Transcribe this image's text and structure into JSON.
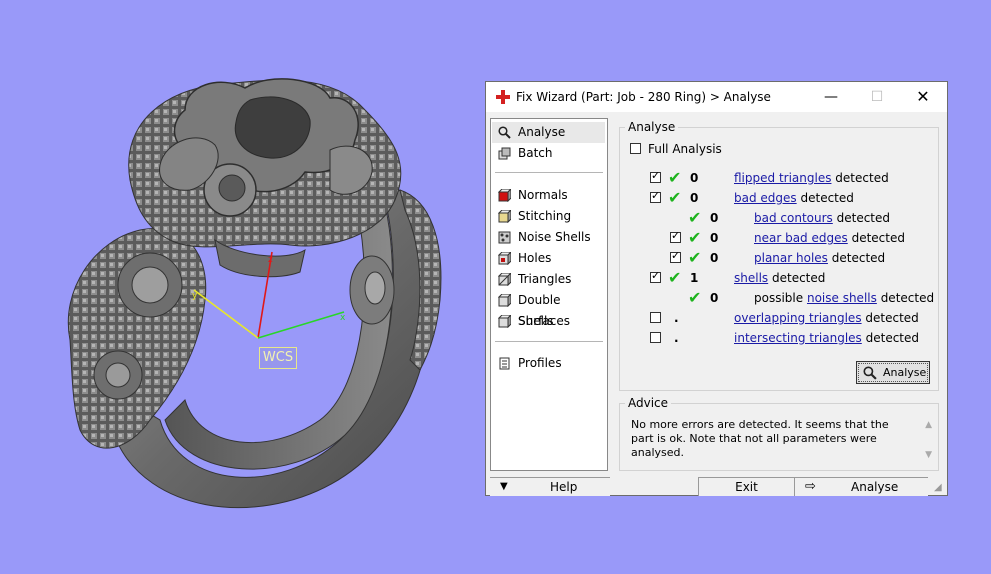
{
  "viewport": {
    "wcs_label": "WCS"
  },
  "dialog": {
    "title": "Fix Wizard (Part: Job - 280 Ring) > Analyse",
    "window_controls": {
      "minimize": "—",
      "maximize": "☐",
      "close": "✕"
    },
    "nav_items": [
      {
        "label": "Analyse",
        "icon": "magnifier-icon",
        "selected": true
      },
      {
        "label": "Batch",
        "icon": "batch-icon"
      },
      {
        "label": "Normals",
        "icon": "normals-cube-icon"
      },
      {
        "label": "Stitching",
        "icon": "stitching-cube-icon"
      },
      {
        "label": "Noise Shells",
        "icon": "noise-shells-icon"
      },
      {
        "label": "Holes",
        "icon": "holes-cube-icon"
      },
      {
        "label": "Triangles",
        "icon": "triangles-cube-icon"
      },
      {
        "label": "Double Surfaces",
        "icon": "double-surfaces-icon"
      },
      {
        "label": "Shells",
        "icon": "shells-cube-icon"
      },
      {
        "label": "Profiles",
        "icon": "profiles-icon"
      }
    ],
    "analyse_group": {
      "title": "Analyse",
      "full_analysis": "Full Analysis",
      "results": [
        {
          "count": "0",
          "link": "flipped triangles",
          "suffix": "detected",
          "checked": true,
          "ok": true
        },
        {
          "count": "0",
          "link": "bad edges",
          "suffix": "detected",
          "checked": true,
          "ok": true
        },
        {
          "count": "0",
          "link": "bad contours",
          "suffix": "detected",
          "ok": true
        },
        {
          "count": "0",
          "link": "near bad edges",
          "suffix": "detected",
          "checked": true,
          "ok": true
        },
        {
          "count": "0",
          "link": "planar holes",
          "suffix": "detected",
          "checked": true,
          "ok": true
        },
        {
          "count": "1",
          "link": "shells",
          "suffix": "detected",
          "checked": true,
          "ok": true
        },
        {
          "count": "0",
          "prefix": "possible",
          "link": "noise shells",
          "suffix": "detected",
          "ok": true
        },
        {
          "count": ".",
          "link": "overlapping triangles",
          "suffix": "detected",
          "checked": false
        },
        {
          "count": ".",
          "link": "intersecting triangles",
          "suffix": "detected",
          "checked": false
        }
      ],
      "analyse_button": "Analyse"
    },
    "advice_group": {
      "title": "Advice",
      "text": "No more errors are detected. It seems that the part is ok. Note that not all parameters were analysed."
    },
    "bottom": {
      "help": "Help",
      "exit": "Exit",
      "analyse": "Analyse"
    }
  }
}
